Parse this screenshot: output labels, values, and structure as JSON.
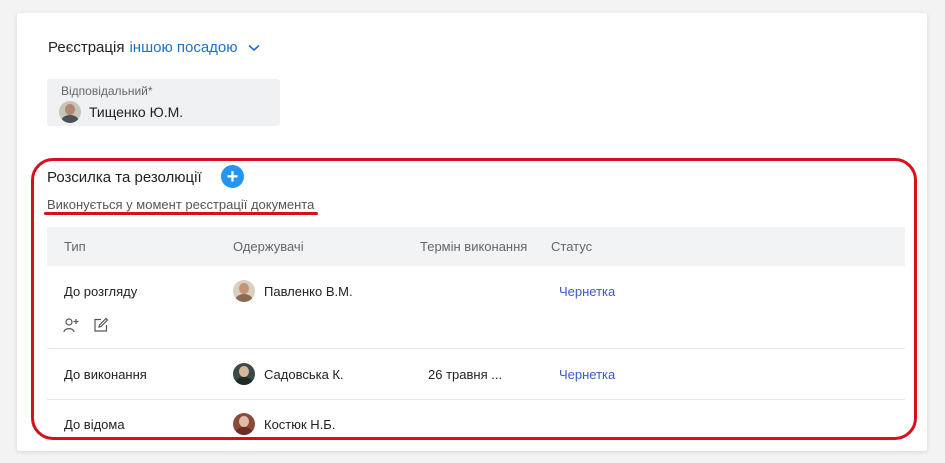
{
  "registration": {
    "prefix": "Реєстрація",
    "link": "іншою посадою"
  },
  "responsible": {
    "label": "Відповідальний*",
    "name": "Тищенко Ю.М."
  },
  "distribution": {
    "title": "Розсилка та резолюції",
    "add_label": "+",
    "subtitle": "Виконується у момент реєстрації документа"
  },
  "table": {
    "headers": [
      "Тип",
      "Одержувачі",
      "Термін виконання",
      "Статус"
    ],
    "rows": [
      {
        "type": "До розгляду",
        "recipient": "Павленко В.М.",
        "term": "",
        "status": "Чернетка"
      },
      {
        "type": "До виконання",
        "recipient": "Садовська К.",
        "term": "26 травня ...",
        "status": "Чернетка"
      },
      {
        "type": "До відома",
        "recipient": "Костюк Н.Б.",
        "term": "",
        "status": ""
      }
    ]
  },
  "colors": {
    "accent": "#1a73c8",
    "add_button": "#2196f3",
    "status_link": "#3a5bc7",
    "highlight": "#d7101e"
  },
  "icons": [
    "chevron-down-icon",
    "add-icon",
    "add-user-icon",
    "edit-icon"
  ]
}
